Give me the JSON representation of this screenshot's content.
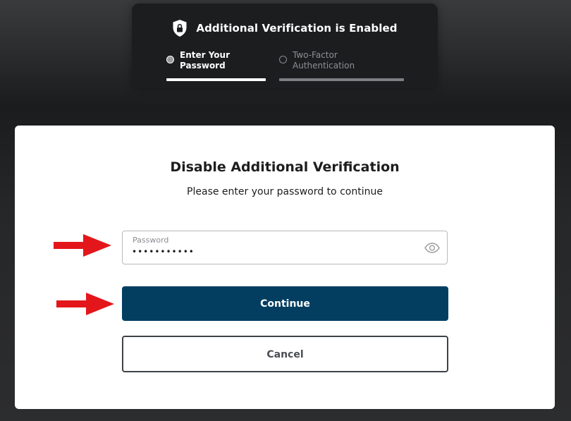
{
  "header": {
    "title": "Additional Verification is Enabled",
    "steps": [
      {
        "label": "Enter Your Password",
        "active": true
      },
      {
        "label": "Two-Factor Authentication",
        "active": false
      }
    ]
  },
  "dialog": {
    "title": "Disable Additional Verification",
    "subtitle": "Please enter your password to continue",
    "password_field": {
      "label": "Password",
      "value": "•••••••••••"
    },
    "continue_label": "Continue",
    "cancel_label": "Cancel"
  },
  "colors": {
    "primary_button": "#033e61",
    "annotation_arrow": "#e3171b",
    "background": "#2c2d2f"
  },
  "icons": {
    "header": "shield-lock-icon",
    "password_toggle": "eye-icon",
    "annotation": "red-arrow-icon"
  }
}
